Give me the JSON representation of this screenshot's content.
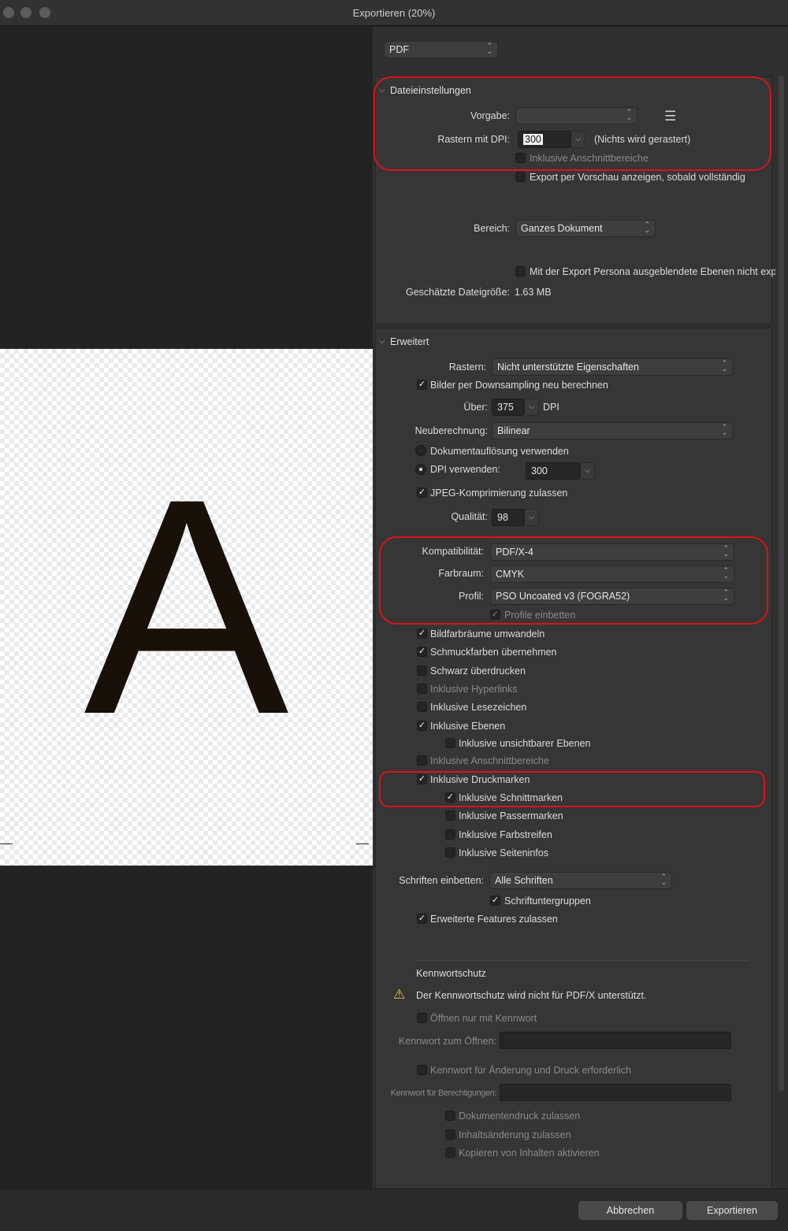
{
  "window": {
    "title": "Exportieren (20%)"
  },
  "preview": {
    "glyph": "A"
  },
  "format": {
    "value": "PDF"
  },
  "file_settings": {
    "header": "Dateieinstellungen",
    "preset_label": "Vorgabe:",
    "preset_value": "",
    "raster_dpi_label": "Rastern mit DPI:",
    "raster_dpi_value": "300",
    "raster_note": "(Nichts wird gerastert)",
    "include_bleed": "Inklusive Anschnittbereiche",
    "preview_after_export": "Export per Vorschau anzeigen, sobald vollständig",
    "area_label": "Bereich:",
    "area_value": "Ganzes Dokument",
    "hidden_layers": "Mit der Export Persona ausgeblendete Ebenen nicht exp",
    "filesize_label": "Geschätzte Dateigröße:",
    "filesize_value": "1.63 MB"
  },
  "advanced": {
    "header": "Erweitert",
    "raster_label": "Rastern:",
    "raster_value": "Nicht unterstützte Eigenschaften",
    "downsample": "Bilder per Downsampling neu berechnen",
    "over_label": "Über:",
    "over_value": "375",
    "over_unit": "DPI",
    "resample_label": "Neuberechnung:",
    "resample_value": "Bilinear",
    "doc_resolution": "Dokumentauflösung verwenden",
    "use_dpi": "DPI verwenden:",
    "use_dpi_value": "300",
    "jpeg": "JPEG-Komprimierung zulassen",
    "quality_label": "Qualität:",
    "quality_value": "98",
    "compat_label": "Kompatibilität:",
    "compat_value": "PDF/X-4",
    "colorspace_label": "Farbraum:",
    "colorspace_value": "CMYK",
    "profile_label": "Profil:",
    "profile_value": "PSO Uncoated v3 (FOGRA52)",
    "embed_profiles": "Profile einbetten",
    "convert_colorspaces": "Bildfarbräume umwandeln",
    "spot_colors": "Schmuckfarben übernehmen",
    "overprint_black": "Schwarz überdrucken",
    "hyperlinks": "Inklusive Hyperlinks",
    "bookmarks": "Inklusive Lesezeichen",
    "layers": "Inklusive Ebenen",
    "hidden_layers": "Inklusive unsichtbarer Ebenen",
    "bleed": "Inklusive Anschnittbereiche",
    "printer_marks": "Inklusive Druckmarken",
    "crop_marks": "Inklusive Schnittmarken",
    "registration_marks": "Inklusive Passermarken",
    "color_bars": "Inklusive Farbstreifen",
    "page_info": "Inklusive Seiteninfos",
    "embed_fonts_label": "Schriften einbetten:",
    "embed_fonts_value": "Alle Schriften",
    "font_subsets": "Schriftuntergruppen",
    "extended_features": "Erweiterte Features zulassen"
  },
  "password": {
    "header": "Kennwortschutz",
    "warning": "Der Kennwortschutz wird nicht für PDF/X unterstützt.",
    "open_with_password": "Öffnen nur mit Kennwort",
    "open_password_label": "Kennwort zum Öffnen:",
    "require_permissions": "Kennwort für Änderung und Druck erforderlich",
    "permissions_password_label": "Kennwort für Berechtigungen:",
    "allow_print": "Dokumentendruck zulassen",
    "allow_changes": "Inhaltsänderung zulassen",
    "allow_copy": "Kopieren von Inhalten aktivieren"
  },
  "buttons": {
    "cancel": "Abbrechen",
    "export": "Exportieren"
  }
}
